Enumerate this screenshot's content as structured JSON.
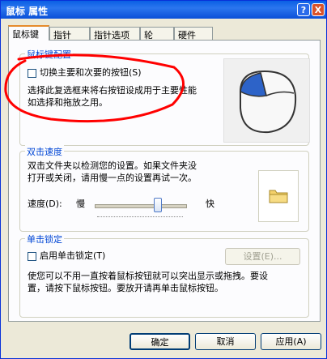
{
  "window": {
    "title": "鼠标 属性",
    "help_label": "?",
    "close_label": "X"
  },
  "tabs": [
    {
      "label": "鼠标键"
    },
    {
      "label": "指针"
    },
    {
      "label": "指针选项"
    },
    {
      "label": "轮"
    },
    {
      "label": "硬件"
    }
  ],
  "button_config": {
    "group_label": "鼠标键配置",
    "switch_checkbox_label": "切换主要和次要的按钮(S)",
    "switch_checked": false,
    "description_line1": "选择此复选框来将右按钮设成用于主要性能",
    "description_line2": "如选择和拖放之用。"
  },
  "double_click": {
    "group_label": "双击速度",
    "description_line1": "双击文件夹以检测您的设置。如果文件夹没",
    "description_line2": "打开或关闭，请用慢一点的设置再试一次。",
    "speed_label": "速度(D):",
    "slow_label": "慢",
    "fast_label": "快",
    "speed_level": 0.7
  },
  "click_lock": {
    "group_label": "单击锁定",
    "enable_label": "启用单击锁定(T)",
    "enabled": false,
    "settings_label": "设置(E)...",
    "description_line1": "使您可以不用一直按着鼠标按钮就可以突出显示或拖拽。要设",
    "description_line2": "置，请按下鼠标按钮。要放开请再单击鼠标按钮。"
  },
  "footer": {
    "ok_label": "确定",
    "cancel_label": "取消",
    "apply_label": "应用(A)"
  },
  "annotation_color": "#ff0000",
  "accent_color": "#0046d5"
}
